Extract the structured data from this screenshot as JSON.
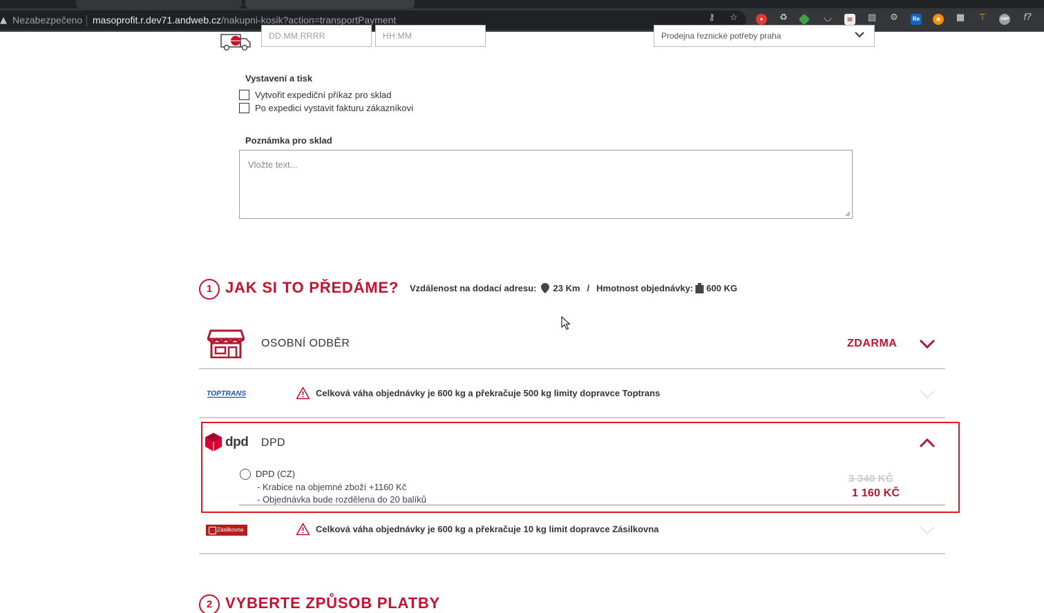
{
  "browser": {
    "security_label": "Nezabezpečeno",
    "url_host": "masoprofit.r.dev71.andweb.cz",
    "url_path": "/nakupni-kosik?action=transportPayment",
    "extension_labels": {
      "re": "Re",
      "abp": "ABP",
      "fx": "f?"
    }
  },
  "pickup_form": {
    "date_placeholder": "DD.MM.RRRR",
    "time_placeholder": "HH:MM",
    "store_value": "Prodejna řeznické potřeby praha"
  },
  "print_section": {
    "heading": "Vystavení a tisk",
    "options": [
      {
        "label": "Vytvořit expediční příkaz pro sklad",
        "checked": false
      },
      {
        "label": "Po expedici vystavit fakturu zákazníkovi",
        "checked": false
      }
    ]
  },
  "note_section": {
    "heading": "Poznámka pro sklad",
    "placeholder": "Vložte text..."
  },
  "delivery": {
    "step_number": "1",
    "title": "JAK SI TO PŘEDÁME?",
    "distance_label": "Vzdálenost na dodací adresu:",
    "distance_value": "23 Km",
    "separator": "/",
    "weight_label": "Hmotnost objednávky:",
    "weight_value": "600 KG",
    "methods": [
      {
        "id": "pickup",
        "title": "OSOBNÍ ODBĚR",
        "price": "ZDARMA",
        "expanded": false
      },
      {
        "id": "toptrans",
        "logo": "TOPTRANS",
        "warning": "Celková váha objednávky je 600 kg a překračuje 500 kg limity dopravce Toptrans",
        "disabled": true
      },
      {
        "id": "dpd",
        "logo": "dpd",
        "title": "DPD",
        "expanded": true,
        "option": {
          "name": "DPD (CZ)",
          "lines": [
            "- Krabice na objemné zboží +1160 Kč",
            "- Objednávka bude rozdělena do 20 balíků"
          ],
          "price_old": "3 340 KČ",
          "price_new": "1 160 KČ",
          "selected": false
        }
      },
      {
        "id": "zasilkovna",
        "logo": "Zásilkovna",
        "warning": "Celková váha objednávky je 600 kg a překračuje 10 kg limit dopravce Zásilkovna",
        "disabled": true
      }
    ]
  },
  "payment": {
    "step_number": "2",
    "title": "VYBERTE ZPŮSOB PLATBY"
  },
  "colors": {
    "brand_red": "#c8102e",
    "highlight_red": "#e0191f",
    "divider": "#cfcfcf",
    "disabled_chevron": "#e6e6e6"
  }
}
